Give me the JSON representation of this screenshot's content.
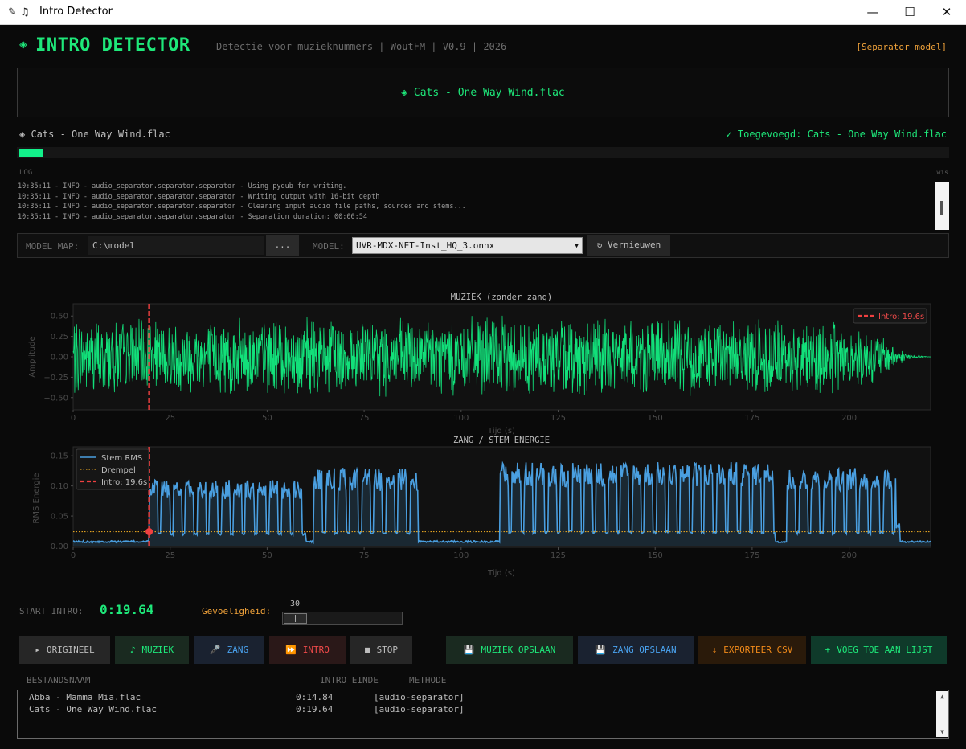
{
  "window": {
    "title": "Intro Detector",
    "icons": "✎ ♫"
  },
  "header": {
    "diamond": "◈",
    "title": "INTRO DETECTOR",
    "subtitle": "Detectie voor muzieknummers | WoutFM | V0.9 | 2026",
    "model_tag": "[Separator model]"
  },
  "now_playing": {
    "text": "◈  Cats - One Way Wind.flac"
  },
  "status": {
    "current_file": "◈ Cats - One Way Wind.flac",
    "added_message": "✓ Toegevoegd: Cats - One Way Wind.flac",
    "progress": 0.026
  },
  "log": {
    "label": "LOG",
    "clear_label": "wis",
    "lines": [
      "10:35:11 - INFO - audio_separator.separator.separator - Using pydub for writing.",
      "10:35:11 - INFO - audio_separator.separator.separator - Writing output with 16-bit depth",
      "10:35:11 - INFO - audio_separator.separator.separator - Clearing input audio file paths, sources and stems...",
      "10:35:11 - INFO - audio_separator.separator.separator - Separation duration: 00:00:54"
    ]
  },
  "model_bar": {
    "map_label": "MODEL MAP:",
    "map_value": "C:\\model",
    "browse_label": "...",
    "model_label": "MODEL:",
    "model_value": "UVR-MDX-NET-Inst_HQ_3.onnx",
    "refresh_label": "↻ Vernieuwen"
  },
  "chart_data": [
    {
      "type": "line",
      "title": "MUZIEK (zonder zang)",
      "xlabel": "Tijd (s)",
      "ylabel": "Amplitude",
      "xlim": [
        0,
        221
      ],
      "ylim": [
        -0.65,
        0.65
      ],
      "yticks": [
        0.5,
        0.25,
        0.0,
        -0.25,
        -0.5
      ],
      "yticklabels": [
        "0.50",
        "0.25",
        "0.00",
        "−0.25",
        "−0.50"
      ],
      "xticks": [
        0,
        25,
        50,
        75,
        100,
        125,
        150,
        175,
        200
      ],
      "xticklabels": [
        "0",
        "25",
        "50",
        "75",
        "100",
        "125",
        "150",
        "175",
        "200"
      ],
      "intro_marker": 19.6,
      "legend": [
        {
          "name": "Intro: 19.6s",
          "color": "#f04040",
          "style": "dashed"
        }
      ],
      "legend_position": "top-right",
      "series_color": "#12e07a",
      "envelope": [
        {
          "x": 0,
          "amp": 0.52
        },
        {
          "x": 20,
          "amp": 0.48
        },
        {
          "x": 40,
          "amp": 0.5
        },
        {
          "x": 80,
          "amp": 0.52
        },
        {
          "x": 120,
          "amp": 0.52
        },
        {
          "x": 160,
          "amp": 0.5
        },
        {
          "x": 200,
          "amp": 0.48
        },
        {
          "x": 208,
          "amp": 0.3
        },
        {
          "x": 213,
          "amp": 0.1
        },
        {
          "x": 217,
          "amp": 0.02
        },
        {
          "x": 221,
          "amp": 0.0
        }
      ]
    },
    {
      "type": "area",
      "title": "ZANG / STEM ENERGIE",
      "xlabel": "Tijd (s)",
      "ylabel": "RMS Energie",
      "xlim": [
        0,
        221
      ],
      "ylim": [
        -0.002,
        0.165
      ],
      "yticks": [
        0.15,
        0.1,
        0.05,
        0.0
      ],
      "yticklabels": [
        "0.15",
        "0.10",
        "0.05",
        "0.00"
      ],
      "xticks": [
        0,
        25,
        50,
        75,
        100,
        125,
        150,
        175,
        200
      ],
      "xticklabels": [
        "0",
        "25",
        "50",
        "75",
        "100",
        "125",
        "150",
        "175",
        "200"
      ],
      "threshold": 0.024,
      "intro_marker": 19.6,
      "legend": [
        {
          "name": "Stem RMS",
          "color": "#4a9fe0",
          "style": "solid"
        },
        {
          "name": "Drempel",
          "color": "#e0a020",
          "style": "dotted"
        },
        {
          "name": "Intro: 19.6s",
          "color": "#f04040",
          "style": "dashed"
        }
      ],
      "legend_position": "top-left",
      "series_color": "#4a9fe0",
      "vocal_segments": [
        [
          19.6,
          60
        ],
        [
          62,
          89
        ],
        [
          110,
          181
        ],
        [
          184,
          213
        ]
      ],
      "segment_peaks": [
        0.1,
        0.12,
        0.13,
        0.12
      ]
    }
  ],
  "intro": {
    "label": "START INTRO:",
    "value": "0:19.64"
  },
  "sensitivity": {
    "label": "Gevoeligheid:",
    "value": "30"
  },
  "buttons": {
    "original": {
      "icon": "▸",
      "label": "ORIGINEEL"
    },
    "music": {
      "icon": "♪",
      "label": "MUZIEK"
    },
    "vocal": {
      "icon": "🎤",
      "label": "ZANG"
    },
    "intro": {
      "icon": "⏩",
      "label": "INTRO"
    },
    "stop": {
      "icon": "■",
      "label": "STOP"
    },
    "save_music": {
      "icon": "💾",
      "label": "MUZIEK OPSLAAN"
    },
    "save_vocal": {
      "icon": "💾",
      "label": "ZANG OPSLAAN"
    },
    "export_csv": {
      "icon": "↓",
      "label": "EXPORTEER CSV"
    },
    "add_to_list": {
      "icon": "+",
      "label": "VOEG TOE AAN LIJST"
    }
  },
  "table": {
    "headers": {
      "name": "BESTANDSNAAM",
      "end": "INTRO EINDE",
      "method": "METHODE"
    },
    "rows": [
      {
        "name": "Abba - Mamma Mia.flac",
        "end": "0:14.84",
        "method": "[audio-separator]"
      },
      {
        "name": "Cats - One Way Wind.flac",
        "end": "0:19.64",
        "method": "[audio-separator]"
      }
    ]
  }
}
